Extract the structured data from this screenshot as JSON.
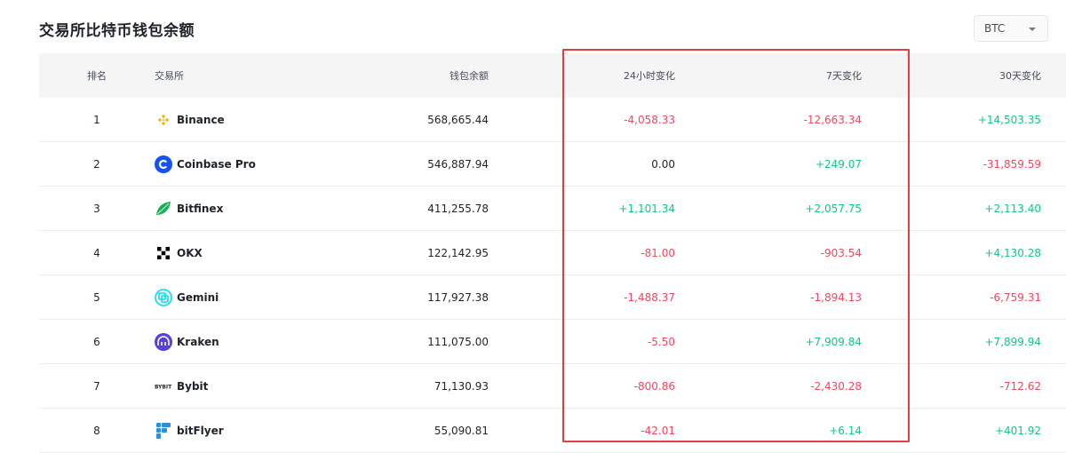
{
  "page": {
    "title": "交易所比特币钱包余额"
  },
  "currency_select": {
    "selected": "BTC"
  },
  "table": {
    "headers": {
      "rank": "排名",
      "exchange": "交易所",
      "balance": "钱包余额",
      "change_24h": "24小时变化",
      "change_7d": "7天变化",
      "change_30d": "30天变化"
    },
    "rows": [
      {
        "rank": "1",
        "exchange": "Binance",
        "icon": "binance-icon",
        "balance": "568,665.44",
        "change_24h": "-4,058.33",
        "change_7d": "-12,663.34",
        "change_30d": "+14,503.35"
      },
      {
        "rank": "2",
        "exchange": "Coinbase Pro",
        "icon": "coinbase-icon",
        "balance": "546,887.94",
        "change_24h": "0.00",
        "change_7d": "+249.07",
        "change_30d": "-31,859.59"
      },
      {
        "rank": "3",
        "exchange": "Bitfinex",
        "icon": "bitfinex-icon",
        "balance": "411,255.78",
        "change_24h": "+1,101.34",
        "change_7d": "+2,057.75",
        "change_30d": "+2,113.40"
      },
      {
        "rank": "4",
        "exchange": "OKX",
        "icon": "okx-icon",
        "balance": "122,142.95",
        "change_24h": "-81.00",
        "change_7d": "-903.54",
        "change_30d": "+4,130.28"
      },
      {
        "rank": "5",
        "exchange": "Gemini",
        "icon": "gemini-icon",
        "balance": "117,927.38",
        "change_24h": "-1,488.37",
        "change_7d": "-1,894.13",
        "change_30d": "-6,759.31"
      },
      {
        "rank": "6",
        "exchange": "Kraken",
        "icon": "kraken-icon",
        "balance": "111,075.00",
        "change_24h": "-5.50",
        "change_7d": "+7,909.84",
        "change_30d": "+7,899.94"
      },
      {
        "rank": "7",
        "exchange": "Bybit",
        "icon": "bybit-icon",
        "balance": "71,130.93",
        "change_24h": "-800.86",
        "change_7d": "-2,430.28",
        "change_30d": "-712.62"
      },
      {
        "rank": "8",
        "exchange": "bitFlyer",
        "icon": "bitflyer-icon",
        "balance": "55,090.81",
        "change_24h": "-42.01",
        "change_7d": "+6.14",
        "change_30d": "+401.92"
      }
    ]
  },
  "colors": {
    "positive": "#0ecb81",
    "negative": "#f6465d",
    "highlight_box": "#e53e3e",
    "binance": "#f0b90b",
    "coinbase": "#1652f0",
    "bitfinex": "#16b157",
    "gemini": "#00dcfa",
    "kraken": "#5741d9",
    "bitflyer": "#2e8fd8"
  }
}
